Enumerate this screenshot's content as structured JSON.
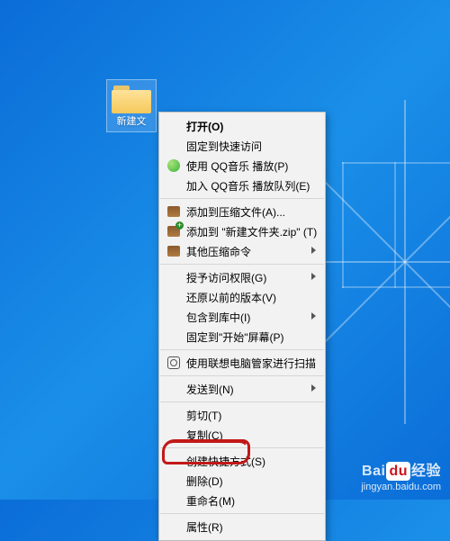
{
  "desktop": {
    "folder": {
      "label": "新建文"
    }
  },
  "context_menu": {
    "open": "打开(O)",
    "pin_quick_access": "固定到快速访问",
    "play_qqmusic": "使用 QQ音乐 播放(P)",
    "add_qqmusic_queue": "加入 QQ音乐 播放队列(E)",
    "add_to_archive": "添加到压缩文件(A)...",
    "add_to_zip": "添加到 \"新建文件夹.zip\" (T)",
    "other_compress": "其他压缩命令",
    "grant_access": "授予访问权限(G)",
    "restore_previous": "还原以前的版本(V)",
    "include_library": "包含到库中(I)",
    "pin_start": "固定到\"开始\"屏幕(P)",
    "lenovo_scan": "使用联想电脑管家进行扫描",
    "send_to": "发送到(N)",
    "cut": "剪切(T)",
    "copy": "复制(C)",
    "create_shortcut": "创建快捷方式(S)",
    "delete": "删除(D)",
    "rename": "重命名(M)",
    "properties": "属性(R)"
  },
  "watermark": {
    "brand_prefix": "Bai",
    "brand_mid": "du",
    "brand_suffix": "经验",
    "url": "jingyan.baidu.com"
  }
}
